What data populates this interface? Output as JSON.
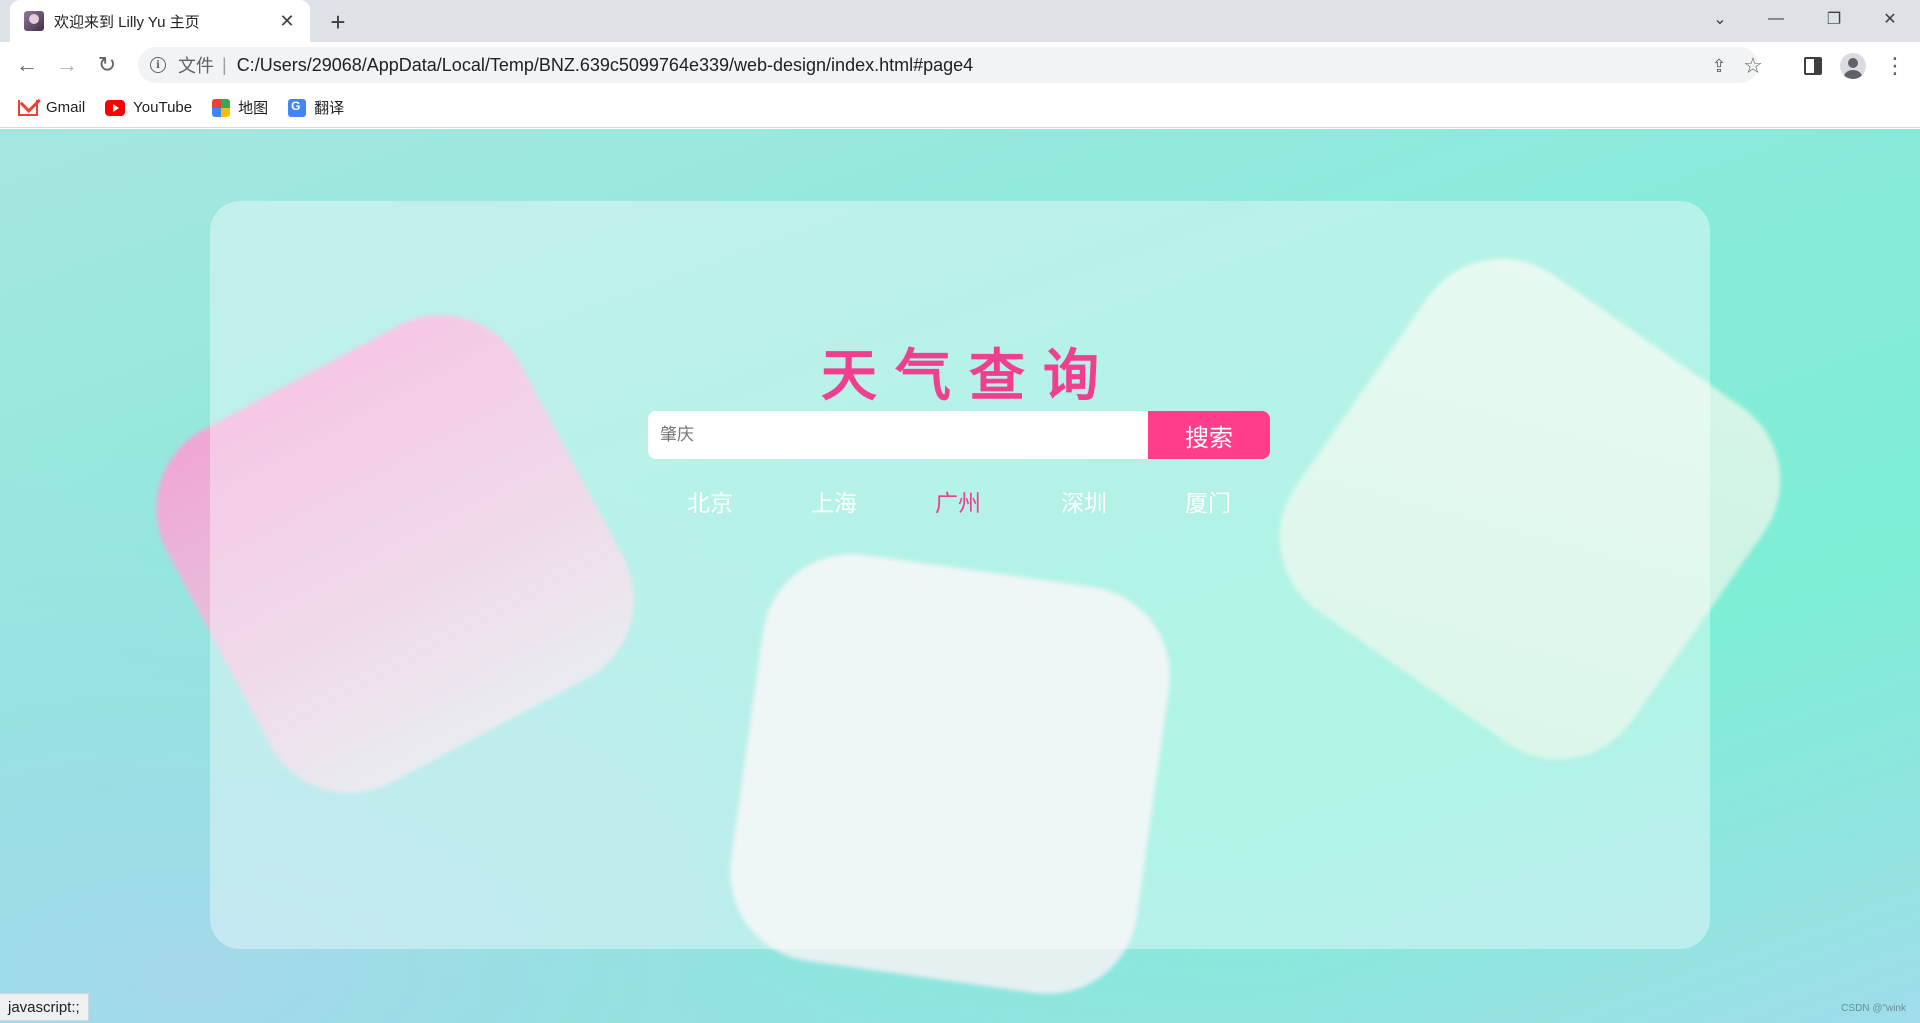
{
  "browser": {
    "tab": {
      "title": "欢迎来到 Lilly Yu 主页",
      "close": "✕"
    },
    "new_tab": "+",
    "window_controls": {
      "tabs_menu": "⌄",
      "minimize": "—",
      "restore": "❐",
      "close": "✕"
    },
    "nav": {
      "back": "←",
      "forward": "→",
      "reload": "↻"
    },
    "address": {
      "info_icon": "i",
      "file_label": "文件",
      "separator": "|",
      "url": "C:/Users/29068/AppData/Local/Temp/BNZ.639c5099764e339/web-design/index.html#page4"
    },
    "omnibox_icons": {
      "share": "⇪",
      "bookmark": "☆"
    },
    "bookmarks": [
      "Gmail",
      "YouTube",
      "地图",
      "翻译"
    ],
    "status_text": "javascript:;"
  },
  "app": {
    "title": "天气查询",
    "search": {
      "placeholder": "肇庆",
      "button": "搜索"
    },
    "cities": [
      "北京",
      "上海",
      "广州",
      "深圳",
      "厦门"
    ],
    "active_city": "广州"
  },
  "watermark": "CSDN @\"wink",
  "colors": {
    "accent": "#ef3f8f",
    "button": "#ff3d8b",
    "background": "#8aeadb"
  }
}
